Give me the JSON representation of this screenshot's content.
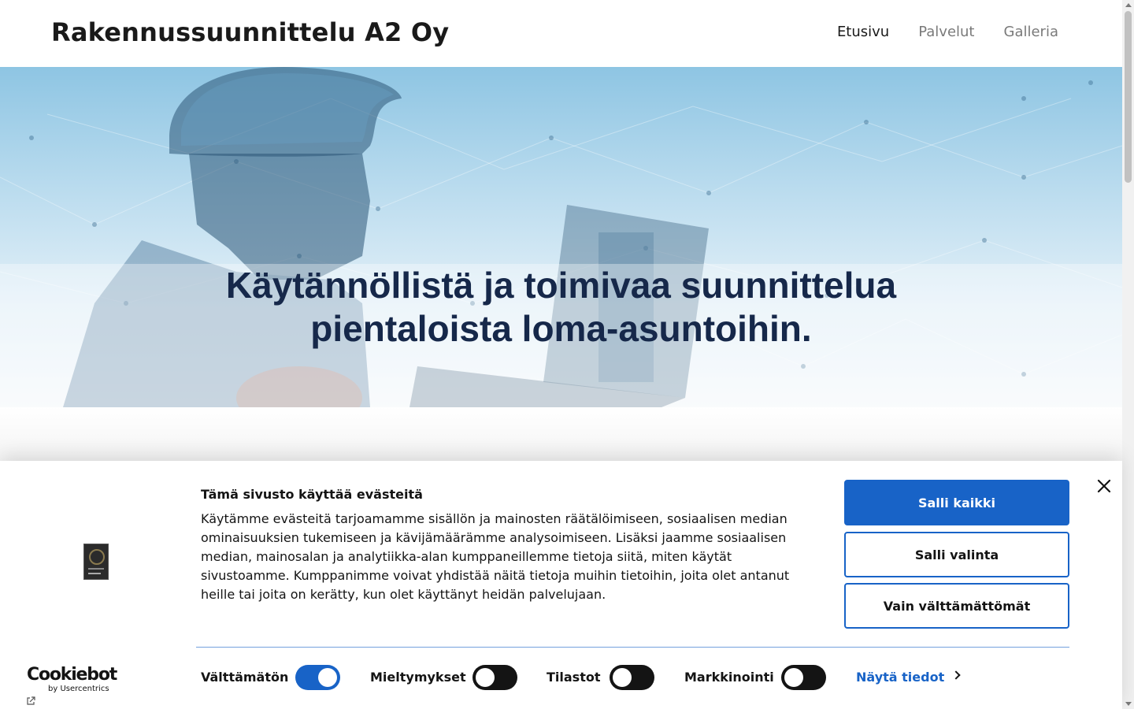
{
  "header": {
    "brand": "Rakennussuunnittelu A2 Oy",
    "nav": [
      {
        "label": "Etusivu",
        "active": true
      },
      {
        "label": "Palvelut",
        "active": false
      },
      {
        "label": "Galleria",
        "active": false
      }
    ]
  },
  "hero": {
    "title_line1": "Käytännöllistä ja toimivaa suunnittelua",
    "title_line2": "pientaloista loma-asuntoihin."
  },
  "cookie_banner": {
    "title": "Tämä sivusto käyttää evästeitä",
    "text": "Käytämme evästeitä tarjoamamme sisällön ja mainosten räätälöimiseen, sosiaalisen median ominaisuuksien tukemiseen ja kävijämäärämme analysoimiseen. Lisäksi jaamme sosiaalisen median, mainosalan ja analytiikka-alan kumppaneillemme tietoja siitä, miten käytät sivustoamme. Kumppanimme voivat yhdistää näitä tietoja muihin tietoihin, joita olet antanut heille tai joita on kerätty, kun olet käyttänyt heidän palvelujaan.",
    "buttons": {
      "allow_all": "Salli kaikki",
      "allow_selection": "Salli valinta",
      "necessary_only": "Vain välttämättömät"
    },
    "toggles": [
      {
        "label": "Välttämätön",
        "on": true
      },
      {
        "label": "Mieltymykset",
        "on": false
      },
      {
        "label": "Tilastot",
        "on": false
      },
      {
        "label": "Markkinointi",
        "on": false
      }
    ],
    "show_details": "Näytä tiedot",
    "provider_logo": "Cookiebot",
    "provider_sub": "by Usercentrics",
    "accent_color": "#1863c7"
  },
  "icons": [
    "close-icon",
    "chevron-right-icon",
    "external-link-icon"
  ]
}
